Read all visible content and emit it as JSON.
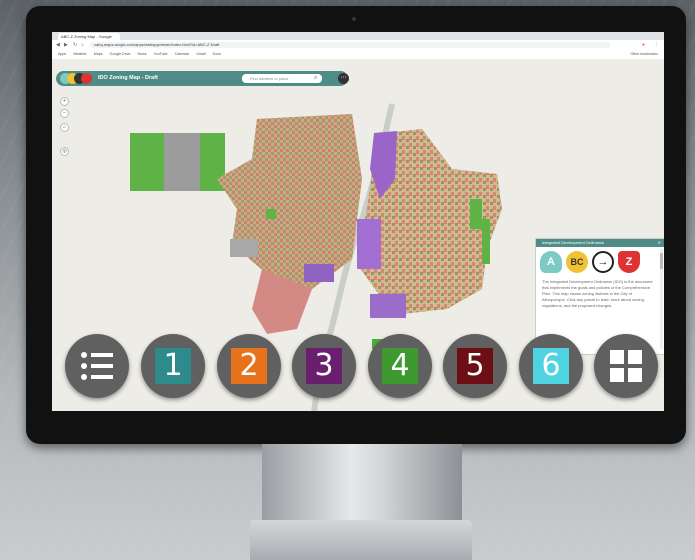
{
  "browser": {
    "tab_title": "ABC-Z Zoning Map - Google",
    "url": "cabq.maps.arcgis.com/apps/webappviewer/index.html?id=ABC-Z Draft",
    "bookmarks": [
      "Apps",
      "Weather",
      "Maps",
      "Google Drive",
      "News",
      "YouTube",
      "Calendar",
      "Gmail",
      "Docs",
      "Other bookmarks"
    ]
  },
  "app": {
    "title": "IDO Zoning Map - Draft",
    "search_placeholder": "Find address or place",
    "menu_icon": "more-icon"
  },
  "info_panel": {
    "title": "Integrated Development Ordinance",
    "badges": [
      "A",
      "BC",
      "→",
      "Z"
    ],
    "body": "The Integrated Development Ordinance (IDO) is the document that implements the goals and policies of the Comprehensive Plan. This map shows zoning districts in the City of Albuquerque. Click any parcel to learn more about zoning, regulations, and the proposed changes."
  },
  "nav_buttons": [
    {
      "label": "",
      "icon": "list-icon",
      "color": "#ffffff"
    },
    {
      "label": "1",
      "color": "#2e8b8b"
    },
    {
      "label": "2",
      "color": "#e8721c"
    },
    {
      "label": "3",
      "color": "#6a1f6e"
    },
    {
      "label": "4",
      "color": "#3e9a2f"
    },
    {
      "label": "5",
      "color": "#6b0f14"
    },
    {
      "label": "6",
      "color": "#4fd3e0"
    },
    {
      "label": "",
      "icon": "grid-icon",
      "color": "#ffffff"
    }
  ]
}
